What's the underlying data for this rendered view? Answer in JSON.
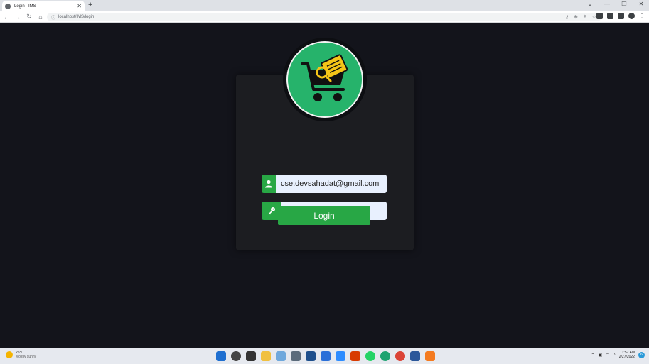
{
  "browser": {
    "tab_title": "Login - IMS",
    "tab_close": "✕",
    "new_tab": "+",
    "url": "localhost/IMS/login",
    "window_controls": [
      "⌄",
      "—",
      "❐",
      "✕"
    ]
  },
  "login": {
    "email_value": "cse.devsahadat@gmail.com",
    "password_value": "••••••",
    "login_label": "Login",
    "logo_icon": "shopping-cart-document-magnifier",
    "accent_color": "#28a745",
    "logo_color": "#26b36b"
  },
  "taskbar": {
    "temperature": "25°C",
    "weather": "Mostly sunny",
    "time": "11:52 AM",
    "date": "2/27/2022",
    "notifications": "6"
  }
}
